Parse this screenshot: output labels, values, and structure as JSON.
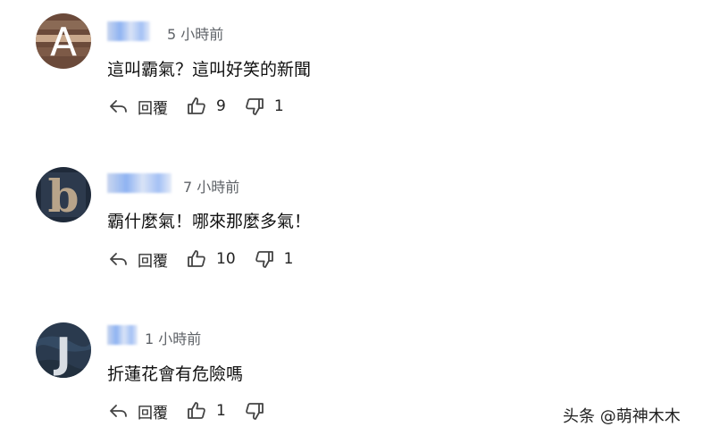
{
  "comments": [
    {
      "avatar_letter": "A",
      "time": "5 小時前",
      "text": "這叫霸氣？這叫好笑的新聞",
      "reply_label": "回覆",
      "likes": "9",
      "dislikes": "1"
    },
    {
      "avatar_letter": "b",
      "time": "7 小時前",
      "text": "霸什麼氣！哪來那麼多氣！",
      "reply_label": "回覆",
      "likes": "10",
      "dislikes": "1"
    },
    {
      "avatar_letter": "J",
      "time": "1 小時前",
      "text": "折蓮花會有危險嗎",
      "reply_label": "回覆",
      "likes": "1",
      "dislikes": ""
    }
  ],
  "watermark": "头条 @萌神木木",
  "icons": {
    "reply": "reply-icon",
    "like": "thumbs-up-icon",
    "dislike": "thumbs-down-icon"
  }
}
